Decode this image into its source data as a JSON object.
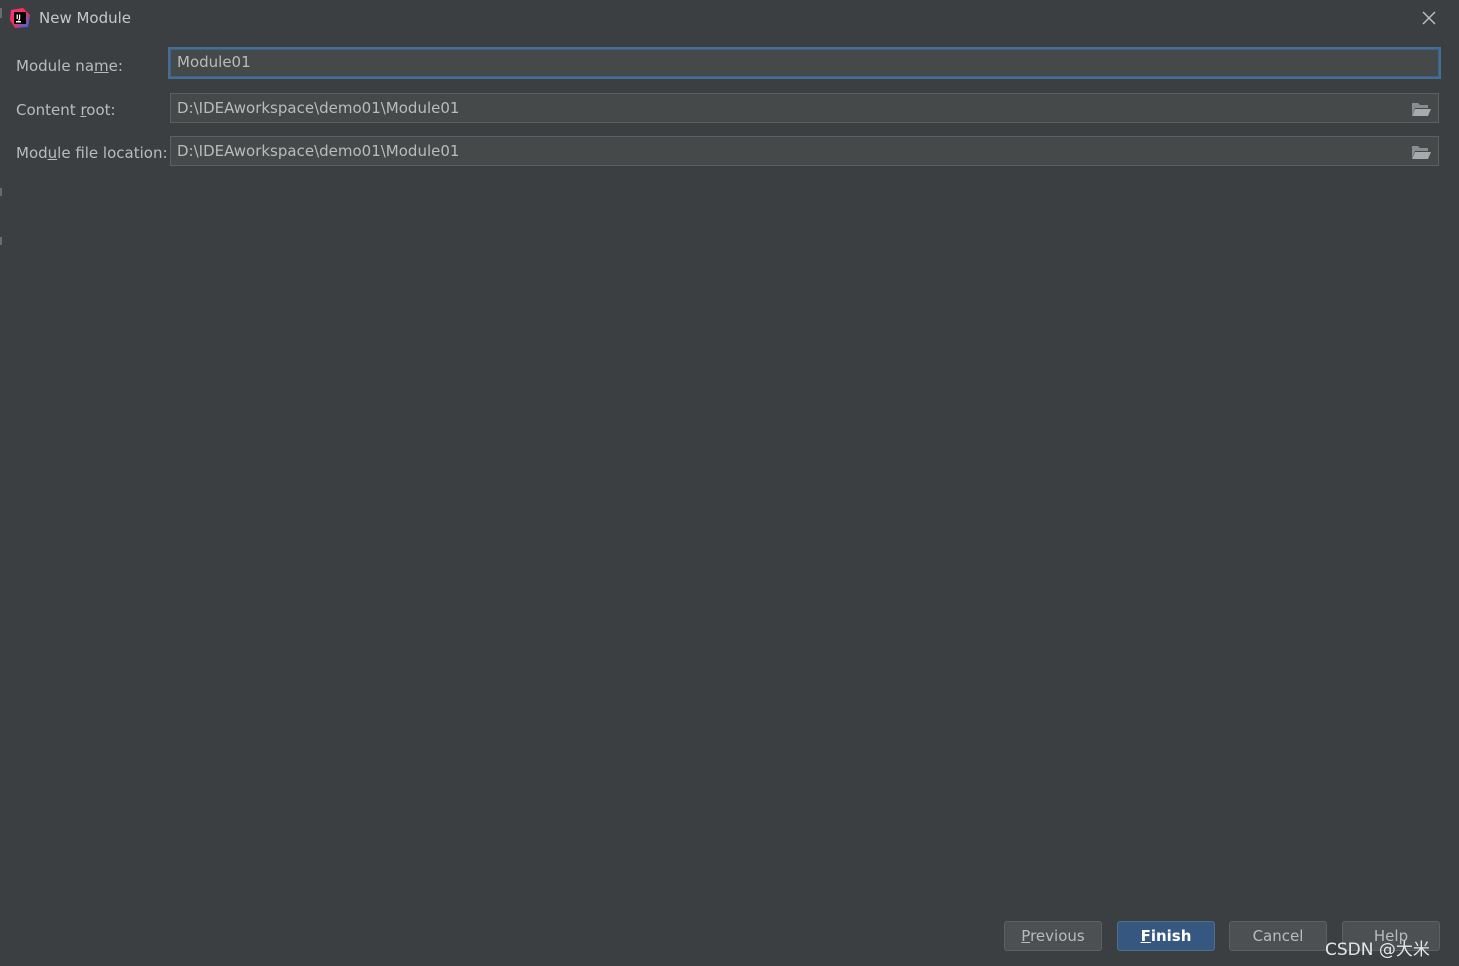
{
  "window": {
    "title": "New Module"
  },
  "form": {
    "module_name": {
      "label_before": "Module na",
      "label_mnemonic": "m",
      "label_after": "e:",
      "value": "Module01"
    },
    "content_root": {
      "label_before": "Content ",
      "label_mnemonic": "r",
      "label_after": "oot:",
      "value": "D:\\IDEAworkspace\\demo01\\Module01"
    },
    "module_file_location": {
      "label_before": "Mod",
      "label_mnemonic": "u",
      "label_after": "le file location:",
      "value": "D:\\IDEAworkspace\\demo01\\Module01"
    }
  },
  "buttons": {
    "previous": {
      "mnemonic": "P",
      "rest": "revious"
    },
    "finish": {
      "mnemonic": "F",
      "rest": "inish"
    },
    "cancel": {
      "label": "Cancel"
    },
    "help": {
      "label": "Help"
    }
  },
  "watermark": "CSDN @大米",
  "colors": {
    "background": "#3c3f41",
    "field_background": "#45494a",
    "focus_border": "#466d94",
    "primary_button": "#365880"
  },
  "icons": {
    "app": "intellij-idea-icon",
    "close": "close-icon",
    "browse": "folder-open-icon"
  }
}
